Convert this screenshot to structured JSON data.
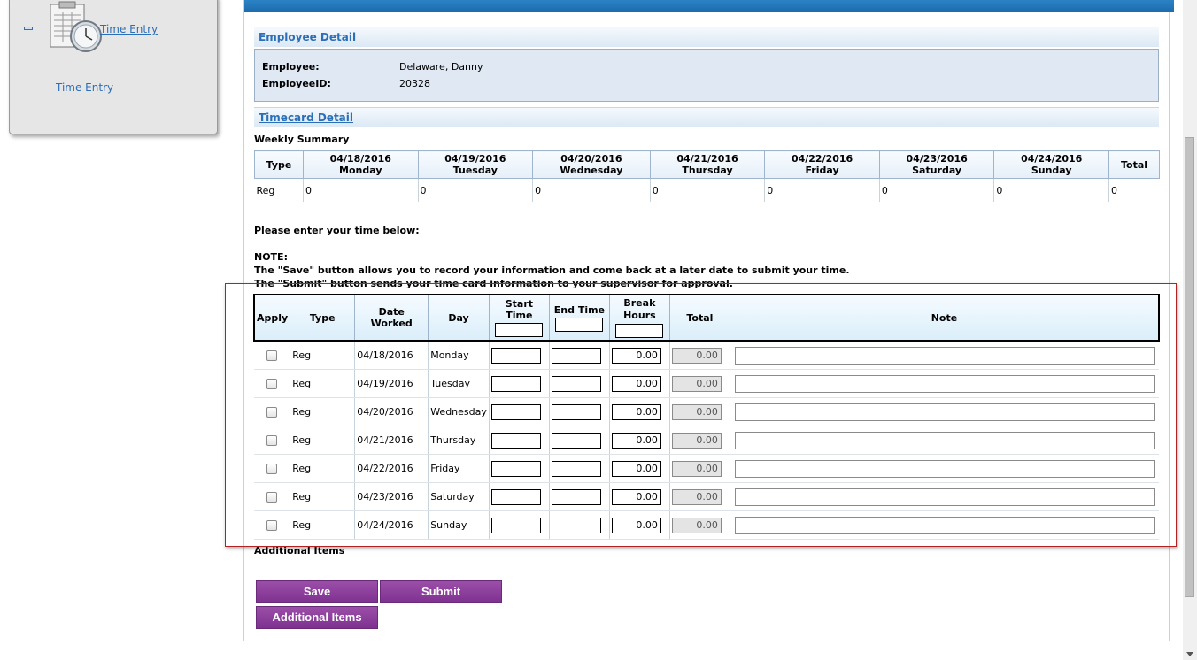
{
  "nav": {
    "main_link": "Time Entry",
    "sub_link": "Time Entry",
    "icon": "timesheet-clock-icon"
  },
  "employee_detail": {
    "header": "Employee Detail",
    "employee_label": "Employee:",
    "employee_value": "Delaware, Danny",
    "id_label": "EmployeeID:",
    "id_value": "20328"
  },
  "timecard_detail": {
    "header": "Timecard Detail",
    "weekly_summary_label": "Weekly Summary"
  },
  "summary": {
    "type_header": "Type",
    "total_header": "Total",
    "days": [
      {
        "date": "04/18/2016",
        "day": "Monday"
      },
      {
        "date": "04/19/2016",
        "day": "Tuesday"
      },
      {
        "date": "04/20/2016",
        "day": "Wednesday"
      },
      {
        "date": "04/21/2016",
        "day": "Thursday"
      },
      {
        "date": "04/22/2016",
        "day": "Friday"
      },
      {
        "date": "04/23/2016",
        "day": "Saturday"
      },
      {
        "date": "04/24/2016",
        "day": "Sunday"
      }
    ],
    "row": {
      "type": "Reg",
      "values": [
        "0",
        "0",
        "0",
        "0",
        "0",
        "0",
        "0",
        "0"
      ]
    }
  },
  "instructions": {
    "enter_time": "Please enter your time below:",
    "note_label": "NOTE:",
    "save_note": "The \"Save\" button allows you to record your information and come back at a later date to submit your time.",
    "submit_note": "The \"Submit\" button sends your time card information to your supervisor for approval."
  },
  "entry": {
    "headers": {
      "apply": "Apply",
      "type": "Type",
      "date_worked": "Date Worked",
      "day": "Day",
      "start_time": "Start Time",
      "end_time": "End Time",
      "break_hours": "Break Hours",
      "total": "Total",
      "note": "Note"
    },
    "rows": [
      {
        "type": "Reg",
        "date": "04/18/2016",
        "day": "Monday",
        "break": "0.00",
        "total": "0.00"
      },
      {
        "type": "Reg",
        "date": "04/19/2016",
        "day": "Tuesday",
        "break": "0.00",
        "total": "0.00"
      },
      {
        "type": "Reg",
        "date": "04/20/2016",
        "day": "Wednesday",
        "break": "0.00",
        "total": "0.00"
      },
      {
        "type": "Reg",
        "date": "04/21/2016",
        "day": "Thursday",
        "break": "0.00",
        "total": "0.00"
      },
      {
        "type": "Reg",
        "date": "04/22/2016",
        "day": "Friday",
        "break": "0.00",
        "total": "0.00"
      },
      {
        "type": "Reg",
        "date": "04/23/2016",
        "day": "Saturday",
        "break": "0.00",
        "total": "0.00"
      },
      {
        "type": "Reg",
        "date": "04/24/2016",
        "day": "Sunday",
        "break": "0.00",
        "total": "0.00"
      }
    ]
  },
  "additional_items_label": "Additional Items",
  "buttons": {
    "save": "Save",
    "submit": "Submit",
    "additional_items": "Additional Items"
  },
  "colors": {
    "accent_blue": "#1d6aaa",
    "button_purple": "#8a3a9c",
    "highlight_red": "#b22222"
  }
}
